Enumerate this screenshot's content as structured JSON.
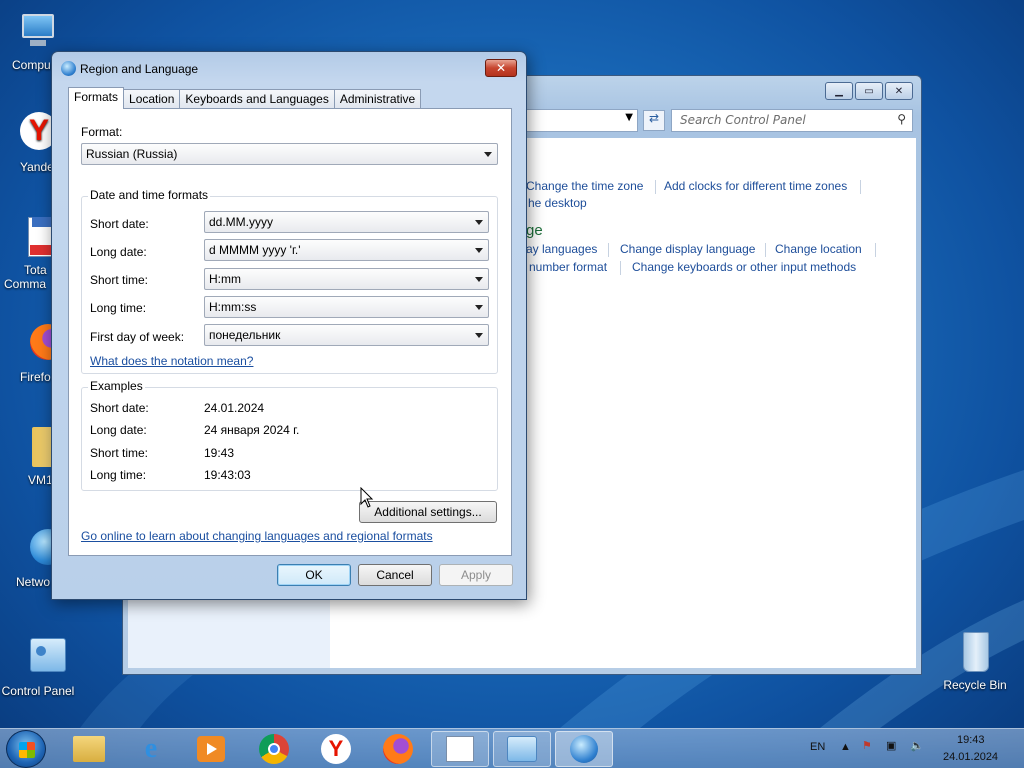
{
  "desktop": {
    "icons": [
      {
        "label": "Compu"
      },
      {
        "label": "Yande"
      },
      {
        "label": "Tota"
      },
      {
        "label": "Comma"
      },
      {
        "label": "Firefo"
      },
      {
        "label": "VM1"
      },
      {
        "label": "Netwo"
      },
      {
        "label": "Control Panel"
      },
      {
        "label": "Recycle Bin"
      }
    ]
  },
  "control_panel": {
    "search_placeholder": "Search Control Panel",
    "links": [
      "Change the time zone",
      "Add clocks for different time zones",
      "he desktop",
      "ay languages",
      "Change display language",
      "Change location",
      "number format",
      "Change keyboards or other input methods"
    ],
    "heading_fragment": "ge"
  },
  "dialog": {
    "title": "Region and Language",
    "close": "✕",
    "tabs": [
      "Formats",
      "Location",
      "Keyboards and Languages",
      "Administrative"
    ],
    "format_label": "Format:",
    "format_value": "Russian (Russia)",
    "datetime_group": "Date and time formats",
    "rows": [
      {
        "label": "Short date:",
        "value": "dd.MM.yyyy"
      },
      {
        "label": "Long date:",
        "value": "d MMMM yyyy 'г.'"
      },
      {
        "label": "Short time:",
        "value": "H:mm"
      },
      {
        "label": "Long time:",
        "value": "H:mm:ss"
      },
      {
        "label": "First day of week:",
        "value": "понедельник"
      }
    ],
    "notation_link": "What does the notation mean?",
    "examples_group": "Examples",
    "examples": [
      {
        "label": "Short date:",
        "value": "24.01.2024"
      },
      {
        "label": "Long date:",
        "value": "24 января 2024 г."
      },
      {
        "label": "Short time:",
        "value": "19:43"
      },
      {
        "label": "Long time:",
        "value": "19:43:03"
      }
    ],
    "additional_settings": "Additional settings...",
    "online_link": "Go online to learn about changing languages and regional formats",
    "ok": "OK",
    "cancel": "Cancel",
    "apply": "Apply"
  },
  "taskbar": {
    "language": "EN",
    "time": "19:43",
    "date": "24.01.2024"
  }
}
